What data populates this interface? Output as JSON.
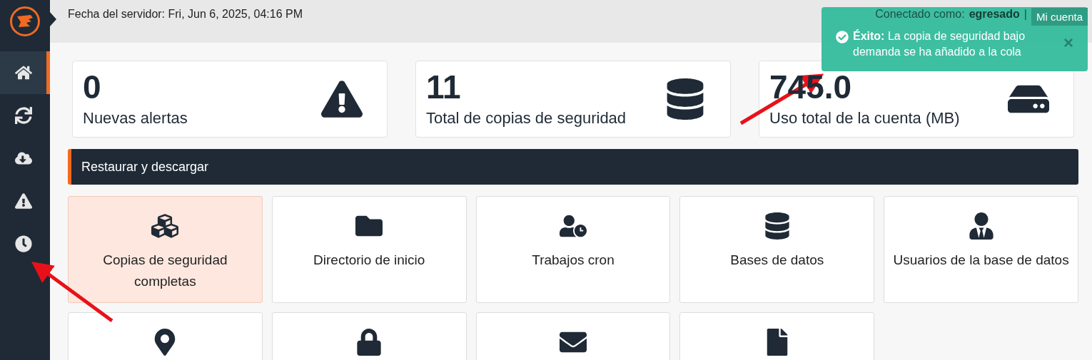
{
  "sidebar": {
    "items": [
      {
        "selected": true
      },
      {
        "selected": false
      },
      {
        "selected": false
      },
      {
        "selected": false
      },
      {
        "selected": false
      }
    ]
  },
  "header": {
    "server_date": "Fecha del servidor: Fri, Jun 6, 2025, 04:16 PM",
    "logged_in_label": "Conectado como:",
    "username": "egresado",
    "separator": "|",
    "account_button": "Mi cuenta"
  },
  "toast": {
    "text": "**Éxito:** La copia de seguridad bajo demanda se ha añadido a la cola",
    "close": "×"
  },
  "stats": [
    {
      "value": "0",
      "label": "Nuevas alertas"
    },
    {
      "value": "11",
      "label": "Total de copias de seguridad"
    },
    {
      "value": "745.0",
      "label": "Uso total de la cuenta (MB)"
    }
  ],
  "section": {
    "title": "Restaurar y descargar"
  },
  "tiles": [
    {
      "label": "Copias de seguridad completas",
      "selected": true
    },
    {
      "label": "Directorio de inicio",
      "selected": false
    },
    {
      "label": "Trabajos cron",
      "selected": false
    },
    {
      "label": "Bases de datos",
      "selected": false
    },
    {
      "label": "Usuarios de la base de datos",
      "selected": false
    },
    {
      "selected": false
    },
    {
      "selected": false
    },
    {
      "selected": false
    },
    {
      "selected": false
    }
  ]
}
